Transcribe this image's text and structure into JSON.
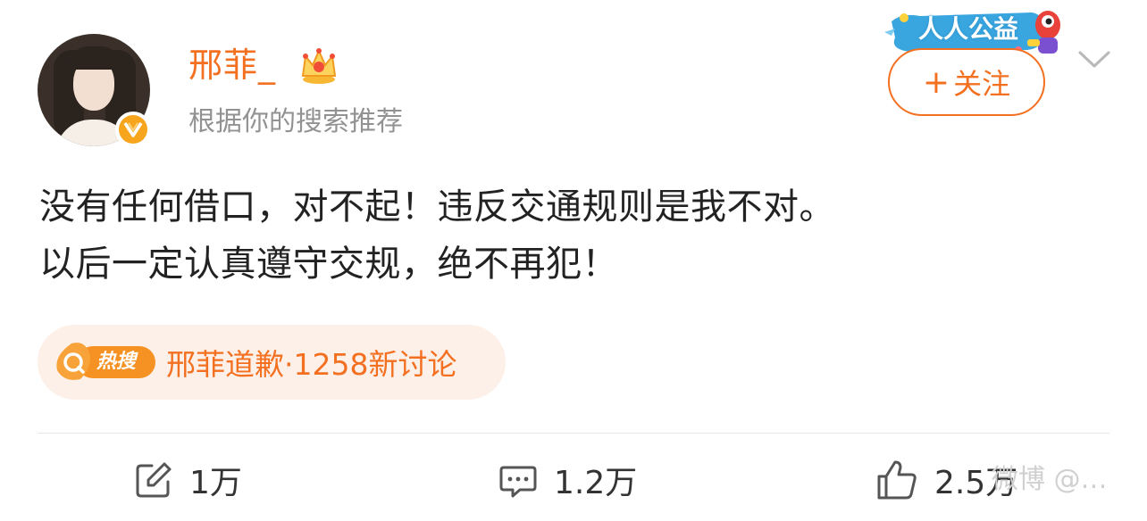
{
  "author": {
    "name": "邢菲_",
    "subtitle": "根据你的搜索推荐",
    "verified_color": "#f7a51c"
  },
  "charity_badge": {
    "text": "人人公益"
  },
  "follow_button": {
    "plus": "+",
    "label": "关注"
  },
  "post": {
    "lines": [
      "没有任何借口，对不起！违反交通规则是我不对。",
      "以后一定认真遵守交规，绝不再犯！"
    ]
  },
  "hot_topic": {
    "badge": "热搜",
    "text": "邢菲道歉·1258新讨论"
  },
  "actions": {
    "repost_count": "1万",
    "comment_count": "1.2万",
    "like_count": "2.5万"
  },
  "watermark": "微博 @…",
  "colors": {
    "accent": "#f37021",
    "text": "#222222",
    "muted": "#929292"
  }
}
